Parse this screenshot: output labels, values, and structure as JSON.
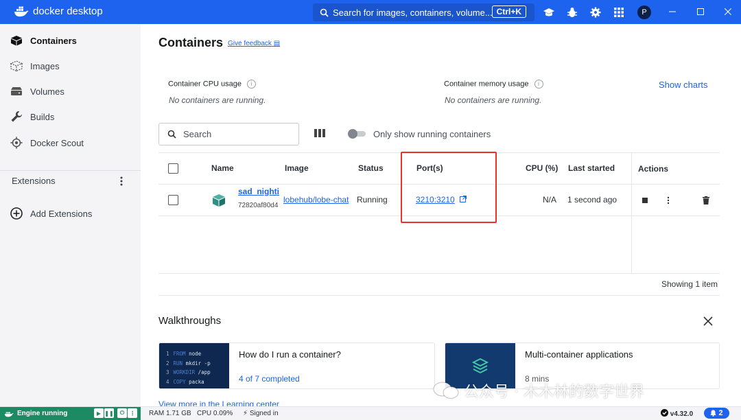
{
  "app": {
    "logo_text": "docker desktop",
    "brand_color": "#1d63ed"
  },
  "titlebar": {
    "search_placeholder": "Search for images, containers, volume...",
    "search_shortcut": "Ctrl+K",
    "avatar_initial": "P",
    "icons": [
      "learning-center-icon",
      "bug-icon",
      "gear-icon",
      "grid-icon"
    ]
  },
  "sidebar": {
    "items": [
      {
        "label": "Containers",
        "icon": "container-icon",
        "active": true
      },
      {
        "label": "Images",
        "icon": "image-icon"
      },
      {
        "label": "Volumes",
        "icon": "volume-icon"
      },
      {
        "label": "Builds",
        "icon": "wrench-icon"
      },
      {
        "label": "Docker Scout",
        "icon": "scout-icon"
      }
    ],
    "extensions_title": "Extensions",
    "add_extensions_label": "Add Extensions"
  },
  "main": {
    "title": "Containers",
    "feedback_label": "Give feedback",
    "cpu_usage_label": "Container CPU usage",
    "cpu_usage_value": "No containers are running.",
    "memory_usage_label": "Container memory usage",
    "memory_usage_value": "No containers are running.",
    "show_charts_label": "Show charts",
    "search_placeholder": "Search",
    "toggle_label": "Only show running containers",
    "table": {
      "headers": {
        "name": "Name",
        "image": "Image",
        "status": "Status",
        "ports": "Port(s)",
        "cpu": "CPU (%)",
        "last_started": "Last started",
        "actions": "Actions"
      },
      "rows": [
        {
          "name": "sad_nightir",
          "id": "72820af80d4",
          "image": "lobehub/lobe-chat",
          "status": "Running",
          "port": "3210:3210",
          "cpu": "N/A",
          "last_started": "1 second ago"
        }
      ]
    },
    "showing_text": "Showing 1 item"
  },
  "walkthroughs": {
    "title": "Walkthroughs",
    "cards": [
      {
        "title": "How do I run a container?",
        "subtitle": "4 of 7 completed",
        "code_lines": [
          {
            "num": "1",
            "kw": "FROM",
            "rest": "node"
          },
          {
            "num": "2",
            "kw": "RUN",
            "rest": "mkdir -p"
          },
          {
            "num": "3",
            "kw": "WORKDIR",
            "rest": "/app"
          },
          {
            "num": "4",
            "kw": "COPY",
            "rest": "packa"
          }
        ]
      },
      {
        "title": "Multi-container applications",
        "subtitle": "8 mins"
      }
    ],
    "learn_more_label": "View more in the Learning center"
  },
  "watermark": {
    "text": "公众号 · 木木林的数字世界"
  },
  "footer": {
    "engine_status": "Engine running",
    "ram": "RAM 1.71 GB",
    "cpu": "CPU 0.09%",
    "signed_in": "Signed in",
    "version": "v4.32.0",
    "notifications_count": "2"
  }
}
